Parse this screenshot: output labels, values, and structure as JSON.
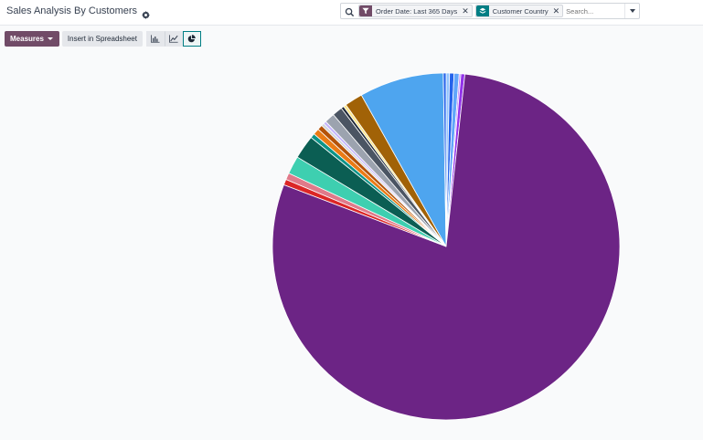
{
  "header": {
    "title": "Sales Analysis By Customers"
  },
  "search": {
    "facets": [
      {
        "label": "Order Date: Last 365 Days",
        "icon": "filter-icon",
        "color": "#714b67"
      },
      {
        "label": "Customer Country",
        "icon": "layers-icon",
        "color": "#017e84"
      }
    ],
    "placeholder": "Search..."
  },
  "toolbar": {
    "measures_label": "Measures",
    "insert_label": "Insert in Spreadsheet",
    "chart_types": [
      "bar",
      "line",
      "pie"
    ],
    "active_chart": "pie"
  },
  "chart_data": {
    "type": "pie",
    "values": [
      {
        "value": 0.3,
        "color": "#93c5fd"
      },
      {
        "value": 0.4,
        "color": "#2563eb"
      },
      {
        "value": 0.45,
        "color": "#60a5fa"
      },
      {
        "value": 0.15,
        "color": "#c084fc"
      },
      {
        "value": 0.35,
        "color": "#9333ea"
      },
      {
        "value": 75.55,
        "color": "#6c2485"
      },
      {
        "value": 0.5,
        "color": "#dc2626"
      },
      {
        "value": 0.6,
        "color": "#e07a8a"
      },
      {
        "value": 1.6,
        "color": "#3ecfb0"
      },
      {
        "value": 2.1,
        "color": "#0b5e53"
      },
      {
        "value": 0.4,
        "color": "#0d9488"
      },
      {
        "value": 0.55,
        "color": "#ea7b15"
      },
      {
        "value": 0.45,
        "color": "#b45309"
      },
      {
        "value": 0.25,
        "color": "#d1d5db"
      },
      {
        "value": 0.25,
        "color": "#c4b5fd"
      },
      {
        "value": 0.9,
        "color": "#9ca3af"
      },
      {
        "value": 0.9,
        "color": "#4b5563"
      },
      {
        "value": 0.25,
        "color": "#1f2937"
      },
      {
        "value": 0.25,
        "color": "#fde68a"
      },
      {
        "value": 1.6,
        "color": "#a16207"
      },
      {
        "value": 7.5,
        "color": "#4ea5ef"
      },
      {
        "value": 0.25,
        "color": "#2563eb"
      }
    ]
  }
}
